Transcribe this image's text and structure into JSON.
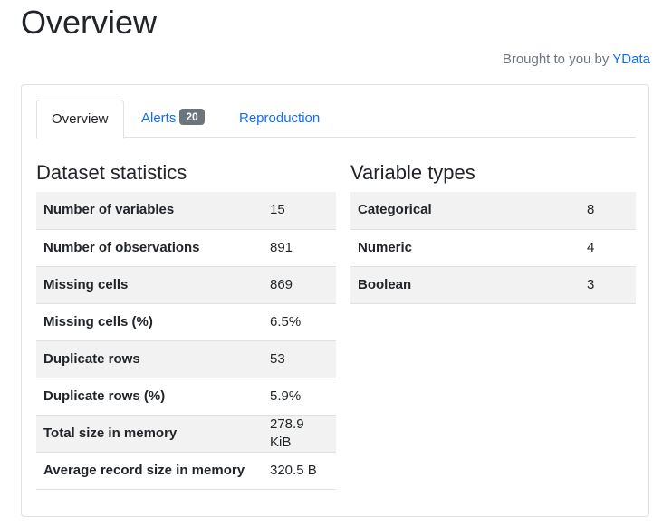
{
  "page": {
    "title": "Overview",
    "credit_prefix": "Brought to you by ",
    "credit_link": "YData"
  },
  "tabs": [
    {
      "label": "Overview",
      "active": true
    },
    {
      "label": "Alerts",
      "badge": "20",
      "active": false
    },
    {
      "label": "Reproduction",
      "active": false
    }
  ],
  "dataset_statistics": {
    "title": "Dataset statistics",
    "rows": [
      {
        "label": "Number of variables",
        "value": "15"
      },
      {
        "label": "Number of observations",
        "value": "891"
      },
      {
        "label": "Missing cells",
        "value": "869"
      },
      {
        "label": "Missing cells (%)",
        "value": "6.5%"
      },
      {
        "label": "Duplicate rows",
        "value": "53"
      },
      {
        "label": "Duplicate rows (%)",
        "value": "5.9%"
      },
      {
        "label": "Total size in memory",
        "value": "278.9 KiB"
      },
      {
        "label": "Average record size in memory",
        "value": "320.5 B"
      }
    ]
  },
  "variable_types": {
    "title": "Variable types",
    "rows": [
      {
        "label": "Categorical",
        "value": "8"
      },
      {
        "label": "Numeric",
        "value": "4"
      },
      {
        "label": "Boolean",
        "value": "3"
      }
    ]
  },
  "colors": {
    "link": "#0d6efd",
    "badge": "#6c757d",
    "stripe": "#f2f2f2"
  }
}
